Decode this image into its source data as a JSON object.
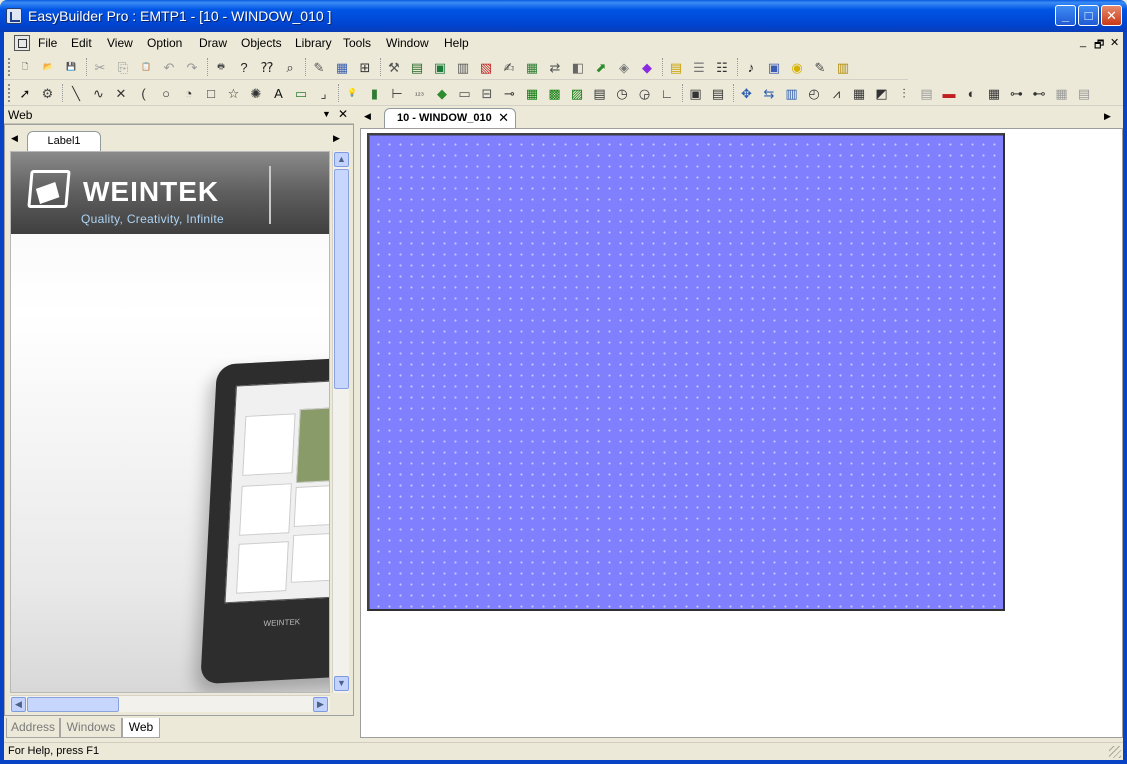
{
  "window": {
    "title": "EasyBuilder Pro : EMTP1 - [10 - WINDOW_010 ]",
    "minimize": "_",
    "maximize": "□",
    "close": "✕"
  },
  "menu": {
    "items": [
      {
        "label": "File"
      },
      {
        "label": "Edit"
      },
      {
        "label": "View"
      },
      {
        "label": "Option"
      },
      {
        "label": "Draw"
      },
      {
        "label": "Objects"
      },
      {
        "label": "Library"
      },
      {
        "label": "Tools"
      },
      {
        "label": "Window"
      },
      {
        "label": "Help"
      }
    ],
    "mdi_minimize": "_",
    "mdi_restore": "🗗",
    "mdi_close": "✕"
  },
  "left_panel": {
    "title": "Web",
    "pin": "▼",
    "close": "✕",
    "tab_prev": "◀",
    "tab_next": "▶",
    "tab": "Label1",
    "web_logo": "WEINTEK",
    "web_tagline": "Quality, Creativity, Infinite",
    "device_brand": "WEINTEK",
    "bottom_tabs": [
      {
        "label": "Address"
      },
      {
        "label": "Windows"
      },
      {
        "label": "Web"
      }
    ],
    "active_bottom_tab": "Web"
  },
  "document": {
    "tab_prev": "◀",
    "tab_next": "▶",
    "tab_label": "10 - WINDOW_010",
    "tab_close": "✕",
    "canvas_color": "#8080ff"
  },
  "status": {
    "text": "For Help, press F1"
  },
  "toolbars": {
    "row1": [
      "new-icon",
      "open-icon",
      "save-icon",
      "cut-icon",
      "copy-icon",
      "paste-icon",
      "undo-icon",
      "redo-icon",
      "print-icon",
      "help-icon",
      "context-help-icon",
      "find-icon",
      "pen-icon",
      "grid-icon",
      "align-icon",
      "tools-icon",
      "compile-icon",
      "simulate-icon",
      "download-icon",
      "sd-icon",
      "edit-icon",
      "table-icon",
      "transfer-icon",
      "resource-icon",
      "export-icon",
      "plugin-icon",
      "library-icon",
      "address-icon",
      "list-icon",
      "text-icon",
      "sound-icon",
      "picture-icon",
      "shape-icon",
      "notes-icon",
      "bars-icon"
    ],
    "row2": [
      "select-icon",
      "property-icon",
      "line-icon",
      "polyline-icon",
      "cross-icon",
      "arc-icon",
      "circle-icon",
      "pie-icon",
      "rect-icon",
      "star-icon",
      "burst-icon",
      "text-a-icon",
      "frame-icon",
      "corner-icon",
      "bulb-icon",
      "switch-icon",
      "scale-icon",
      "numeric-icon",
      "diamond-icon",
      "button-icon",
      "slider-icon",
      "key-icon",
      "number-icon",
      "ascii-icon",
      "abc-icon",
      "display-icon",
      "clock-icon",
      "chart-icon",
      "axis-icon",
      "window-icon",
      "popup-icon",
      "move-icon",
      "shuffle-icon",
      "bar-chart-icon",
      "meter-icon",
      "trend-icon",
      "table-grid-icon",
      "image-icon",
      "histogram-icon",
      "list-grid-icon",
      "minus-icon",
      "gauge-icon",
      "calendar-icon",
      "tree-icon",
      "tree2-icon",
      "misc-icon",
      "misc2-icon"
    ]
  }
}
